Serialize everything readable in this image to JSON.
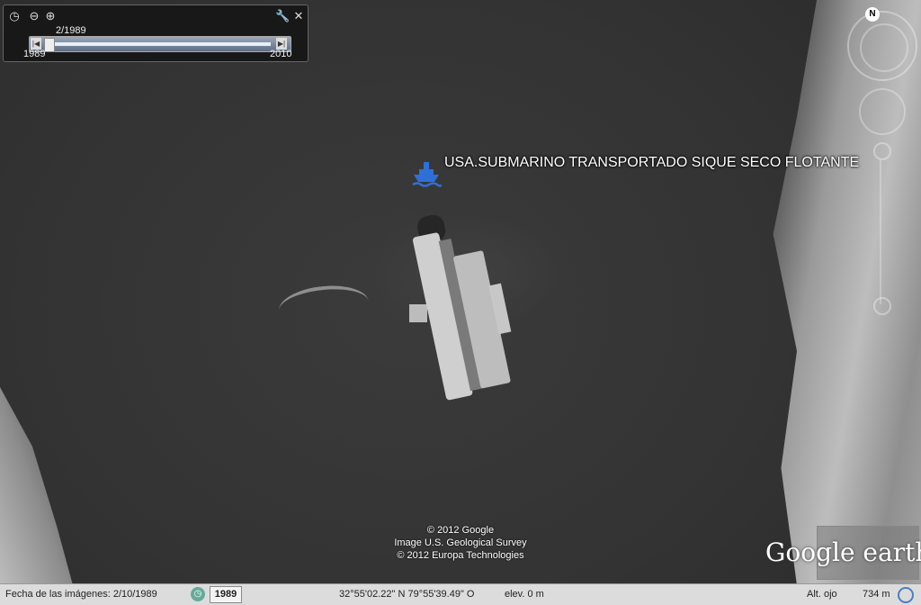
{
  "placemark": {
    "label": "USA.SUBMARINO TRANSPORTADO  SIQUE SECO FLOTANTE",
    "icon": "ship-icon"
  },
  "time_slider": {
    "current_date": "2/1989",
    "min_year": "1989",
    "max_year": "2010",
    "position_fraction": 0.0,
    "icons": {
      "clock": "clock-icon",
      "zoom_out": "zoom-out-icon",
      "zoom_in": "zoom-in-icon",
      "settings": "wrench-icon",
      "close": "close-icon",
      "prev": "step-back-icon",
      "next": "step-forward-icon"
    }
  },
  "navigation": {
    "north": "N"
  },
  "attribution": [
    "© 2012 Google",
    "Image U.S. Geological Survey",
    "© 2012 Europa Technologies"
  ],
  "logo": {
    "text": "Google earth"
  },
  "status": {
    "imagery_date_label": "Fecha de las imágenes: 2/10/1989",
    "historical_year": "1989",
    "coordinates": "32°55'02.22\" N  79°55'39.49\" O",
    "elevation": "elev.     0 m",
    "eye_alt_label": "Alt. ojo",
    "eye_alt_value": "734 m"
  },
  "colors": {
    "status_bar": "#dcdcdc",
    "water": "#3a3a3a",
    "accent": "#4b7fc4"
  }
}
